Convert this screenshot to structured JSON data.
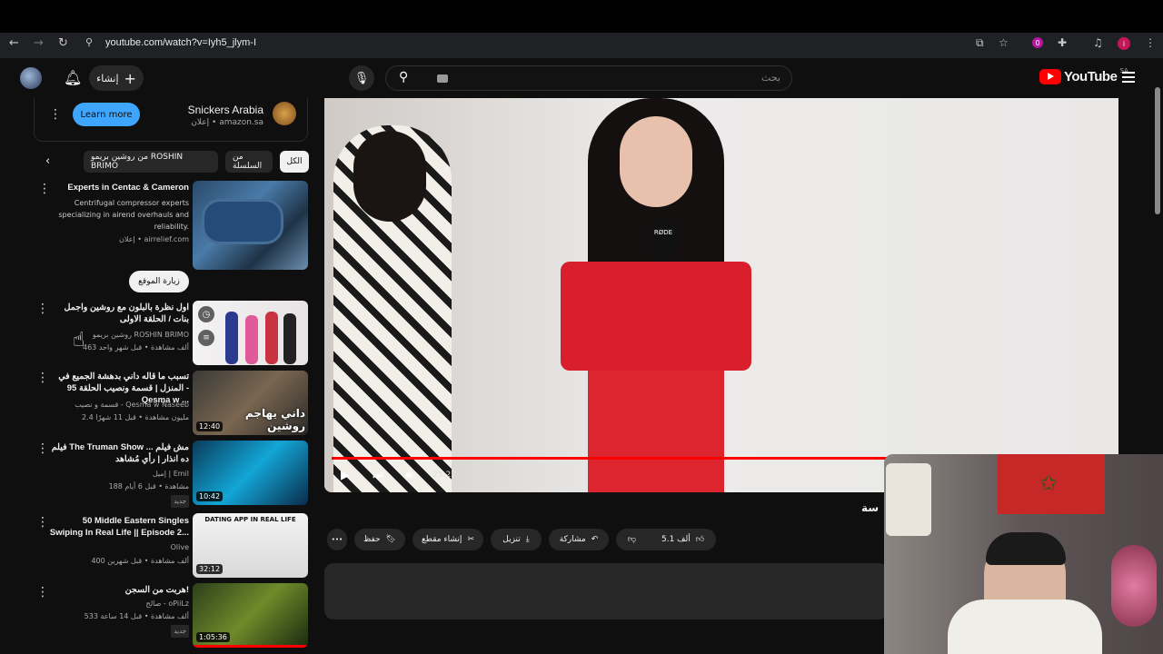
{
  "browser": {
    "url": "youtube.com/watch?v=Iyh5_jlym-I",
    "nav": {
      "back": "←",
      "forward": "→",
      "reload": "↻",
      "site_info": "⚲"
    },
    "icons": [
      "cast-icon",
      "star-icon",
      "extension-icon",
      "puzzle-icon",
      "media-icon",
      "profile-icon",
      "menu-dots-icon"
    ],
    "ext_labels": [
      "0",
      "i"
    ]
  },
  "header": {
    "create_label": "إنشاء",
    "search_placeholder": "بحث",
    "logo_text": "YouTube",
    "country_code": "SA"
  },
  "ad": {
    "advertiser": "Snickers Arabia",
    "meta": "إعلان • amazon.sa",
    "cta": "Learn more"
  },
  "chips": [
    {
      "label": "الكل",
      "active": true
    },
    {
      "label": "من السلسلة",
      "active": false
    },
    {
      "label": "من روشين بريمو ROSHIN BRIMO",
      "active": false
    }
  ],
  "ad2": {
    "title": "Experts in Centac & Cameron",
    "desc": "Centrifugal compressor experts specializing in airend overhauls and reliability.",
    "meta": "إعلان • airrelief.com",
    "cta": "زيارة الموقع"
  },
  "videos": [
    {
      "title": "اول نظرة بالبلون مع روشين واجمل بنات / الحلقة الاولى",
      "channel": "روشين بريمو ROSHIN BRIMO",
      "stats": "463 ألف مشاهدة • قبل شهر واحد",
      "duration": "",
      "badge": ""
    },
    {
      "title": "تسبب ما قاله داني بدهشة الجميع في المنزل | قسمة ونصيب الحلقة 95 - Qesma w ...",
      "channel": "قسمة و نصيب - Qesma w Naseeb",
      "stats": "2.4 مليون مشاهدة • قبل 11 شهرًا",
      "duration": "12:40",
      "badge": ""
    },
    {
      "title": "فيلم The Truman Show مش فيلم ... ده انذار | رأي مُشاهد",
      "channel": "إميل | Emil",
      "stats": "188 مشاهدة • قبل 6 أيام",
      "duration": "10:42",
      "badge": "جديد"
    },
    {
      "title": "50 Middle Eastern Singles Swiping In Real Life || Episode 2...",
      "channel": "Olive",
      "stats": "400 ألف مشاهدة • قبل شهرين",
      "duration": "32:12",
      "badge": ""
    },
    {
      "title": "هربت من السجن!",
      "channel": "صالح - oPiiLz",
      "stats": "533 ألف مشاهدة • قبل 14 ساعة",
      "duration": "1:05:36",
      "badge": "جديد"
    }
  ],
  "thumb_texts": {
    "t2": "داني يهاجم روشين",
    "t4": "DATING APP IN REAL LIFE"
  },
  "player": {
    "time": "25:23 / 25:40",
    "progress": 0.9886,
    "mic_brand": "RØDE"
  },
  "actions": {
    "likes": "5.1 ألف",
    "share": "مشاركة",
    "download": "تنزيل",
    "clip": "إنشاء مقطع",
    "save": "حفظ",
    "more": "•••"
  },
  "title_fragment": "سة"
}
